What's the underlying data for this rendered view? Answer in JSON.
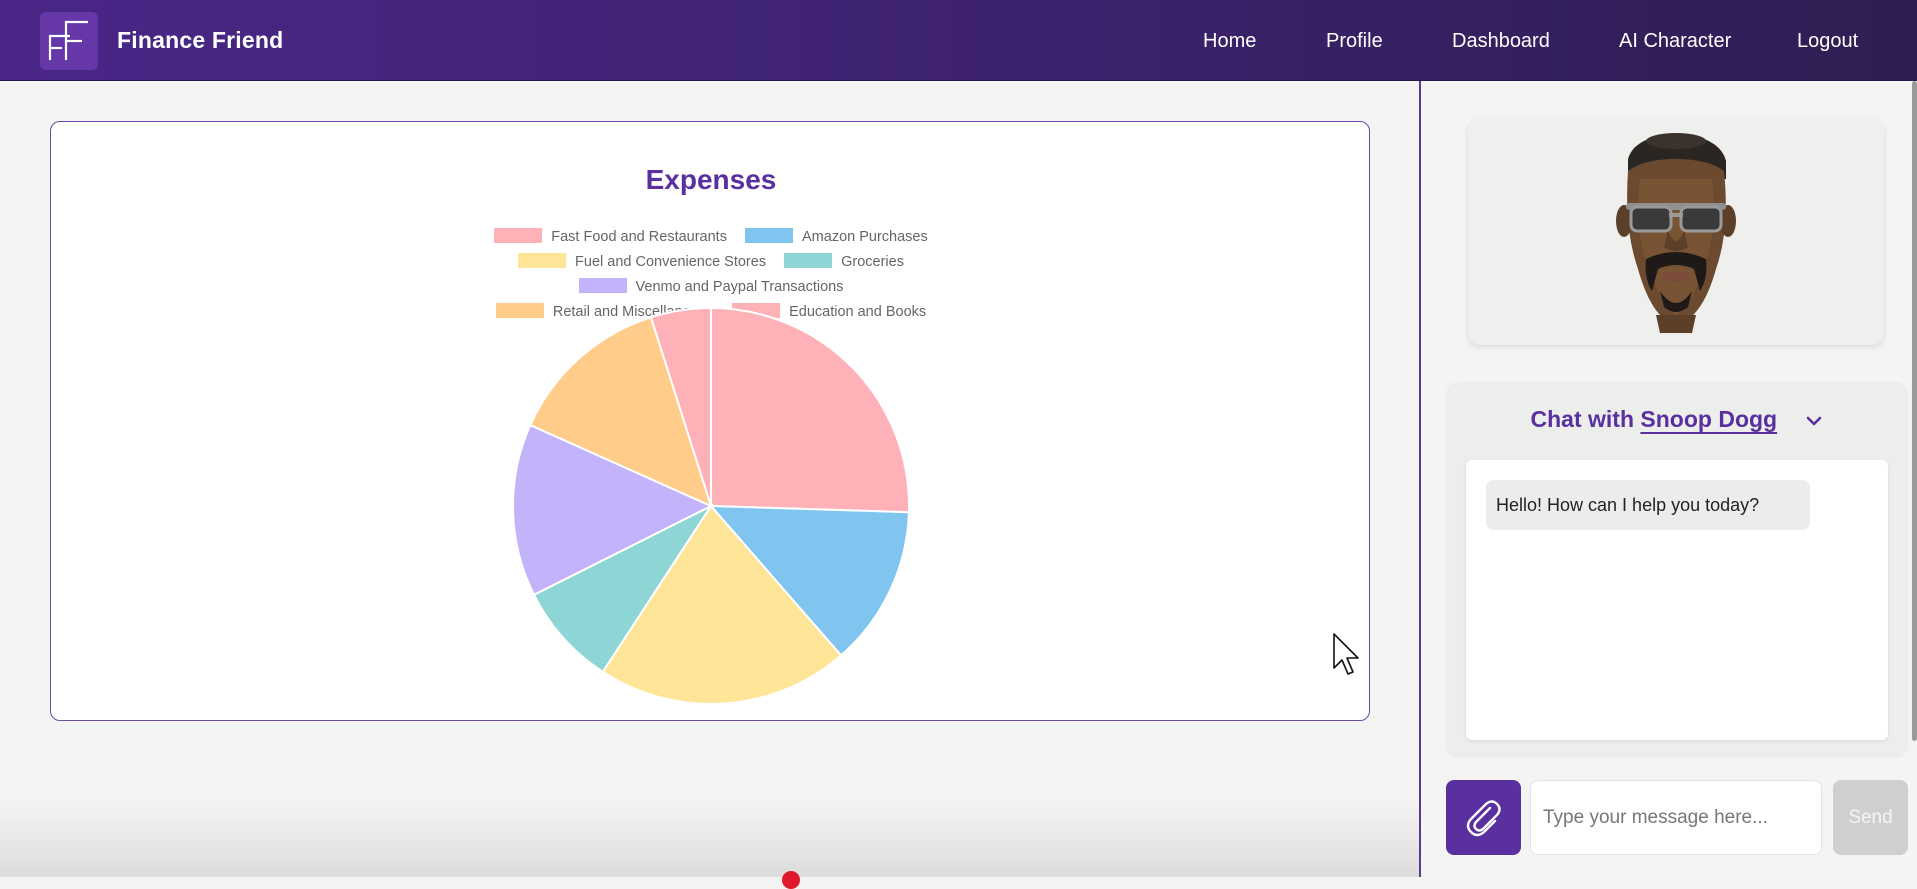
{
  "app": {
    "brand": "Finance Friend",
    "logo_letters": "FF"
  },
  "nav": {
    "items": [
      {
        "label": "Home"
      },
      {
        "label": "Profile"
      },
      {
        "label": "Dashboard"
      },
      {
        "label": "AI Character"
      },
      {
        "label": "Logout"
      }
    ]
  },
  "chart_data": {
    "type": "pie",
    "title": "Expenses",
    "legend_position": "top",
    "categories": [
      "Fast Food and Restaurants",
      "Amazon Purchases",
      "Fuel and Convenience Stores",
      "Groceries",
      "Venmo and Paypal Transactions",
      "Retail and Miscellaneous",
      "Education and Books"
    ],
    "values": [
      25.5,
      13.1,
      20.6,
      8.4,
      14.1,
      13.4,
      4.9
    ],
    "colors": [
      "#ffb1b8",
      "#80c4f0",
      "#ffe597",
      "#8ed6d6",
      "#c3b3fb",
      "#ffcc8a",
      "#ffb1b8"
    ]
  },
  "chat": {
    "title_prefix": "Chat with",
    "character_name": "Snoop Dogg",
    "avatar_alt": "Snoop Dogg avatar",
    "messages": [
      {
        "from": "ai",
        "text": "Hello! How can I help you today?"
      }
    ],
    "input_placeholder": "Type your message here...",
    "send_label": "Send"
  }
}
